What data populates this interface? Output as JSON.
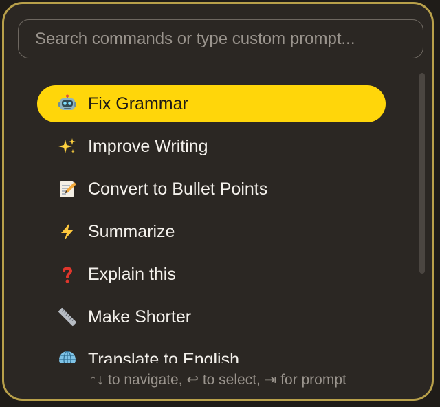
{
  "search": {
    "placeholder": "Search commands or type custom prompt..."
  },
  "commands": [
    {
      "label": "Fix Grammar",
      "icon": "robot-icon",
      "selected": true
    },
    {
      "label": "Improve Writing",
      "icon": "sparkles-icon",
      "selected": false
    },
    {
      "label": "Convert to Bullet Points",
      "icon": "memo-icon",
      "selected": false
    },
    {
      "label": "Summarize",
      "icon": "lightning-icon",
      "selected": false
    },
    {
      "label": "Explain this",
      "icon": "question-mark-icon",
      "selected": false
    },
    {
      "label": "Make Shorter",
      "icon": "ruler-icon",
      "selected": false
    },
    {
      "label": "Translate to English",
      "icon": "globe-icon",
      "selected": false
    }
  ],
  "footer": {
    "hint": "↑↓ to navigate, ↩ to select, ⇥ for prompt"
  },
  "colors": {
    "accent": "#ffd60a",
    "panel": "#2b2723",
    "border": "#b8a04a"
  }
}
